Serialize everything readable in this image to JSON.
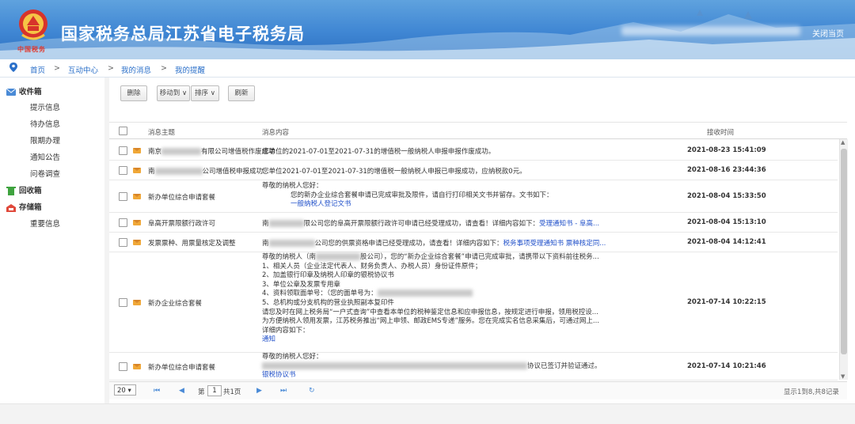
{
  "header": {
    "emblem_text": "中国税务",
    "title": "国家税务总局江苏省电子税务局",
    "close_link": "关闭当页"
  },
  "breadcrumb": [
    "首页",
    "互动中心",
    "我的消息",
    "我的提醒"
  ],
  "breadcrumb_sep": ">",
  "sidebar": {
    "groups": [
      {
        "label": "收件箱",
        "icon": "inbox-icon",
        "items": [
          "提示信息",
          "待办信息",
          "限期办理",
          "通知公告",
          "问卷调查"
        ]
      },
      {
        "label": "回收箱",
        "icon": "trash-icon",
        "items": []
      },
      {
        "label": "存储箱",
        "icon": "storage-icon",
        "items": [
          "重要信息"
        ]
      }
    ]
  },
  "toolbar": {
    "delete": "删除",
    "move_to": "移动到 ∨",
    "sort": "排序 ∨",
    "refresh": "刷新"
  },
  "table": {
    "headers": {
      "subject": "消息主题",
      "content": "消息内容",
      "time": "接收时间"
    },
    "rows": [
      {
        "subject_pre": "南京",
        "subject_post": "有限公司增值税作废成功",
        "content": [
          "您单位的2021-07-01至2021-07-31的增值税一般纳税人申报申报作废成功。"
        ],
        "time": "2021-08-23 15:41:09"
      },
      {
        "subject_pre": "南",
        "subject_post": "公司增值税申报成功",
        "content": [
          "您单位2021-07-01至2021-07-31的增值税一般纳税人申报已申报成功，应纳税款0元。"
        ],
        "time": "2021-08-16 23:44:36"
      },
      {
        "subject": "新办单位综合申请套餐",
        "content": [
          "尊敬的纳税人您好：",
          "您的新办企业综合套餐申请已完成审批及限件，请自行打印相关文书并留存。文书如下："
        ],
        "link": "一般纳税人登记文书",
        "time": "2021-08-04 15:33:50"
      },
      {
        "subject": "阜高开票限额行政许可",
        "content_pre": "南",
        "content_post": "限公司您的阜高开票限额行政许可申请已经受理成功，请查看！详细内容如下：",
        "link": "受理通知书 - 阜高...",
        "time": "2021-08-04 15:13:10"
      },
      {
        "subject": "发票票种、用票量核定及调整",
        "content_pre": "南",
        "content_post": "公司您的供票资格申请已经受理成功，请查看！详细内容如下：",
        "link": "税务事项受理通知书 票种核定同...",
        "time": "2021-08-04 14:12:41"
      },
      {
        "subject": "新办企业综合套餐",
        "content": [
          "尊敬的纳税人（南",
          "1、相关人员（企业法定代表人、财务负责人、办税人员）身份证件原件；",
          "2、加盖银行印章及纳税人印章的银税协议书",
          "3、单位公章及发票专用章",
          "4、资料领取面单号：（您的面单号为：",
          "5、总机构或分支机构的营业执照副本复印件",
          "请您及时在网上税务局“一户式查询”中查看本单位的税种鉴定信息和应申报信息，按规定进行申报，领用税控设...",
          "为方便纳税人领用发票，江苏税务推出“网上申领、邮政EMS专递”服务。您在完成实名信息采集后，可通过网上...",
          "详细内容如下："
        ],
        "line0_post": "股公司），您的“新办企业综合套餐”申请已完成审批，请携带以下资料前往税务...",
        "link": "通知",
        "time": "2021-07-14 10:22:15"
      },
      {
        "subject": "新办单位综合申请套餐",
        "content": [
          "尊敬的纳税人您好："
        ],
        "content_tail": "协议已签订并验证通过。",
        "link": "银税协议书",
        "time": "2021-07-14 10:21:46"
      }
    ]
  },
  "pager": {
    "page_size": "20",
    "page_label_pre": "第",
    "current_page": "1",
    "page_label_post": "共1页",
    "summary": "显示1到8,共8记录"
  }
}
